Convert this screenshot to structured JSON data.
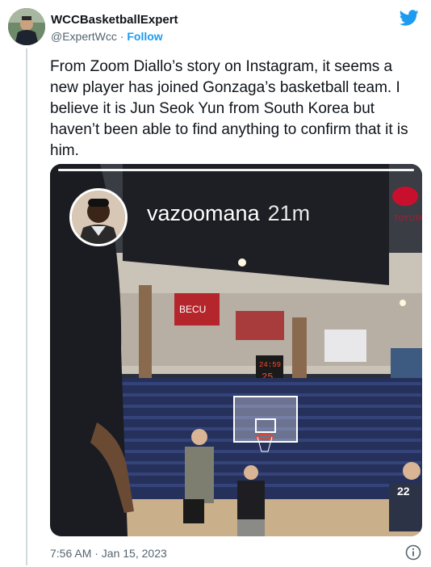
{
  "author": {
    "name": "WCCBasketballExpert",
    "handle": "@ExpertWcc",
    "separator": "·",
    "follow_label": "Follow"
  },
  "tweet": {
    "text": "From Zoom Diallo’s story on Instagram, it seems a new player has joined Gonzaga’s basketball team. I believe it is Jun Seok Yun from South Korea but haven’t been able to find anything to confirm that it is him."
  },
  "media": {
    "story_username": "vazoomana",
    "story_age": "21m",
    "story_progress": 1.0,
    "scoreboard_top": "0",
    "shot_clock": "24:59",
    "shot_clock_2": "25",
    "banner_becu": "BECU",
    "jersey_number": "22",
    "toyota": "TOYOTA"
  },
  "footer": {
    "timestamp": "7:56 AM · Jan 15, 2023"
  },
  "colors": {
    "accent": "#1d9bf0",
    "secondary_text": "#536471"
  },
  "icons": [
    "twitter-bird-icon",
    "info-icon"
  ]
}
